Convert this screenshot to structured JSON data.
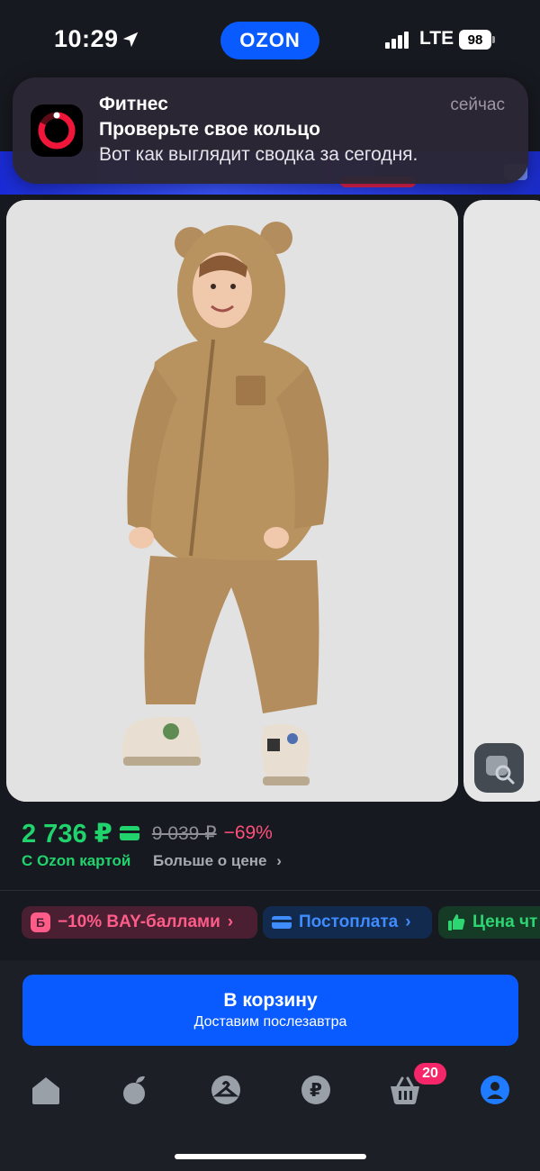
{
  "status_bar": {
    "time": "10:29",
    "brand": "OZON",
    "network": "LTE",
    "battery": "98"
  },
  "notification": {
    "app": "Фитнес",
    "time": "сейчас",
    "title": "Проверьте свое кольцо",
    "body": "Вот как выглядит сводка за сегодня."
  },
  "product": {
    "price": "2 736 ₽",
    "old_price": "9 039 ₽",
    "discount": "−69%",
    "ozon_card": "С Ozon картой",
    "more_price": "Больше о цене"
  },
  "chips": [
    {
      "label": "−10% BAY-баллами"
    },
    {
      "label": "Постоплата"
    },
    {
      "label": "Цена чт"
    }
  ],
  "cart_button": {
    "title": "В корзину",
    "subtitle": "Доставим послезавтра"
  },
  "tab_bar": {
    "cart_badge": "20"
  },
  "colors": {
    "accent": "#0a5bff",
    "price_green": "#21d36d",
    "discount_pink": "#ff4f7b",
    "badge": "#f5276a"
  }
}
